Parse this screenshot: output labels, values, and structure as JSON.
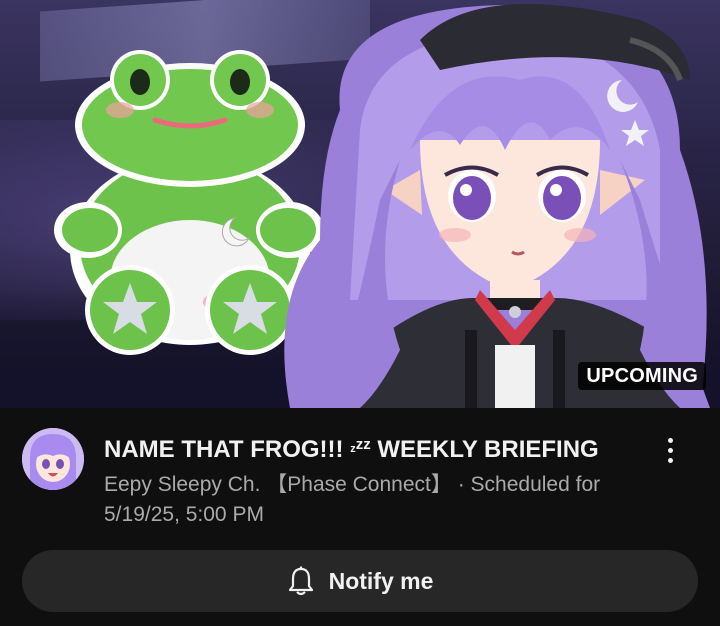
{
  "thumbnail": {
    "badge": "UPCOMING",
    "subjects": [
      "frog-plush",
      "vtuber-character"
    ]
  },
  "video": {
    "title_prefix": "NAME THAT FROG!!!",
    "title_zz": "z",
    "title_zz_small": "zz",
    "title_suffix": "WEEKLY BRIEFING",
    "channel": "Eepy Sleepy Ch. 【Phase Connect】",
    "separator": "·",
    "schedule_label": "Scheduled for",
    "scheduled_time": "5/19/25, 5:00 PM"
  },
  "actions": {
    "notify_label": "Notify me",
    "notify_icon": "bell-icon",
    "menu_icon": "more-vert-icon"
  },
  "colors": {
    "background": "#0f0f0f",
    "button_bg": "#272727",
    "meta_text": "#aaaaaa",
    "primary_text": "#f1f1f1",
    "accent_purple": "#a98bf0"
  }
}
